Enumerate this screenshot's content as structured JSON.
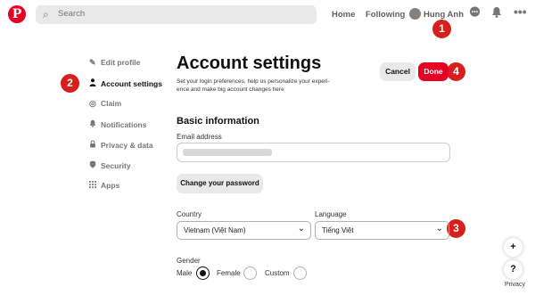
{
  "topbar": {
    "logo": "P",
    "search_placeholder": "Search",
    "nav": {
      "home": "Home",
      "following": "Following"
    },
    "user_name": "Hung Anh"
  },
  "sidebar": {
    "items": [
      {
        "label": "Edit profile",
        "icon": "pencil-icon"
      },
      {
        "label": "Account settings",
        "icon": "person-icon",
        "active": true
      },
      {
        "label": "Claim",
        "icon": "globe-icon"
      },
      {
        "label": "Notifications",
        "icon": "bell-icon"
      },
      {
        "label": "Privacy & data",
        "icon": "lock-icon"
      },
      {
        "label": "Security",
        "icon": "shield-icon"
      },
      {
        "label": "Apps",
        "icon": "grid-icon"
      }
    ]
  },
  "main": {
    "title": "Account settings",
    "subtitle": "Set your login preferences, help us personalize your experi- ence and make big account changes here",
    "cancel_label": "Cancel",
    "done_label": "Done",
    "basic_info_heading": "Basic information",
    "email_label": "Email address",
    "change_password_label": "Change your password",
    "country_label": "Country",
    "country_value": "Vietnam (Việt Nam)",
    "language_label": "Language",
    "language_value": "Tiếng Việt",
    "gender_label": "Gender",
    "gender_options": {
      "male": "Male",
      "female": "Female",
      "custom": "Custom"
    },
    "gender_selected": "Male"
  },
  "annotations": {
    "b1": "1",
    "b2": "2",
    "b3": "3",
    "b4": "4"
  },
  "fab": {
    "plus": "+",
    "help": "?",
    "privacy": "Privacy"
  },
  "colors": {
    "brand_red": "#e60023",
    "badge_red": "#d5201c"
  }
}
